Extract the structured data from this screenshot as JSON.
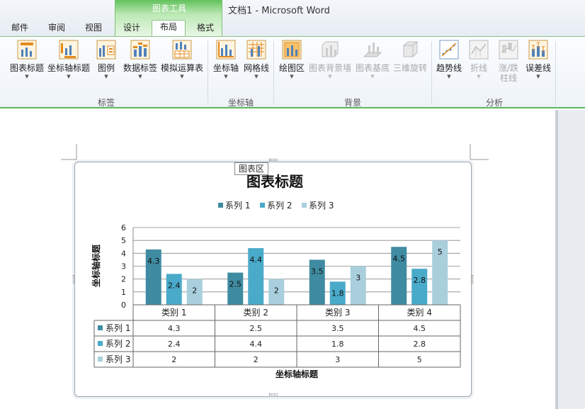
{
  "window": {
    "context_tool_label": "图表工具",
    "doc_title": "文档1  -  Microsoft Word"
  },
  "tabs": [
    {
      "label": "邮件"
    },
    {
      "label": "审阅"
    },
    {
      "label": "视图"
    },
    {
      "label": "设计"
    },
    {
      "label": "布局"
    },
    {
      "label": "格式"
    }
  ],
  "ribbon": {
    "groups": [
      {
        "label": "标签"
      },
      {
        "label": "坐标轴"
      },
      {
        "label": "背景"
      },
      {
        "label": "分析"
      }
    ],
    "buttons": [
      {
        "label": "图表标题",
        "icon": "chart-title-icon"
      },
      {
        "label": "坐标轴标题",
        "icon": "axis-title-icon"
      },
      {
        "label": "图例",
        "icon": "legend-icon"
      },
      {
        "label": "数据标签",
        "icon": "data-labels-icon"
      },
      {
        "label": "模拟运算表",
        "icon": "data-table-icon"
      },
      {
        "label": "坐标轴",
        "icon": "axes-icon"
      },
      {
        "label": "网格线",
        "icon": "gridlines-icon"
      },
      {
        "label": "绘图区",
        "icon": "plot-area-icon"
      },
      {
        "label": "图表背景墙",
        "icon": "chart-wall-icon"
      },
      {
        "label": "图表基底",
        "icon": "chart-floor-icon"
      },
      {
        "label": "三维旋转",
        "icon": "3d-rotation-icon"
      },
      {
        "label": "趋势线",
        "icon": "trendline-icon"
      },
      {
        "label": "折线",
        "icon": "lines-icon"
      },
      {
        "label": "涨/跌",
        "label2": "柱线",
        "icon": "up-down-bars-icon"
      },
      {
        "label": "误差线",
        "icon": "error-bars-icon"
      }
    ]
  },
  "tooltip": "图表区",
  "colors": {
    "series1": "#3f8ba1",
    "series2": "#4aaac9",
    "series3": "#a9cfdc",
    "ribbon_accent": "#5cb85c"
  },
  "chart_data": {
    "type": "bar",
    "title": "图表标题",
    "xlabel": "坐标轴标题",
    "ylabel": "坐标轴标题",
    "categories": [
      "类别 1",
      "类别 2",
      "类别 3",
      "类别 4"
    ],
    "series": [
      {
        "name": "系列 1",
        "values": [
          4.3,
          2.5,
          3.5,
          4.5
        ]
      },
      {
        "name": "系列 2",
        "values": [
          2.4,
          4.4,
          1.8,
          2.8
        ]
      },
      {
        "name": "系列 3",
        "values": [
          2,
          2,
          3,
          5
        ]
      }
    ],
    "yticks": [
      "0",
      "1",
      "2",
      "3",
      "4",
      "5",
      "6"
    ],
    "ylim": [
      0,
      6
    ],
    "grid": true,
    "legend": "top",
    "data_labels": true,
    "data_table": [
      [
        "4.3",
        "2.5",
        "3.5",
        "4.5"
      ],
      [
        "2.4",
        "4.4",
        "1.8",
        "2.8"
      ],
      [
        "2",
        "2",
        "3",
        "5"
      ]
    ]
  }
}
